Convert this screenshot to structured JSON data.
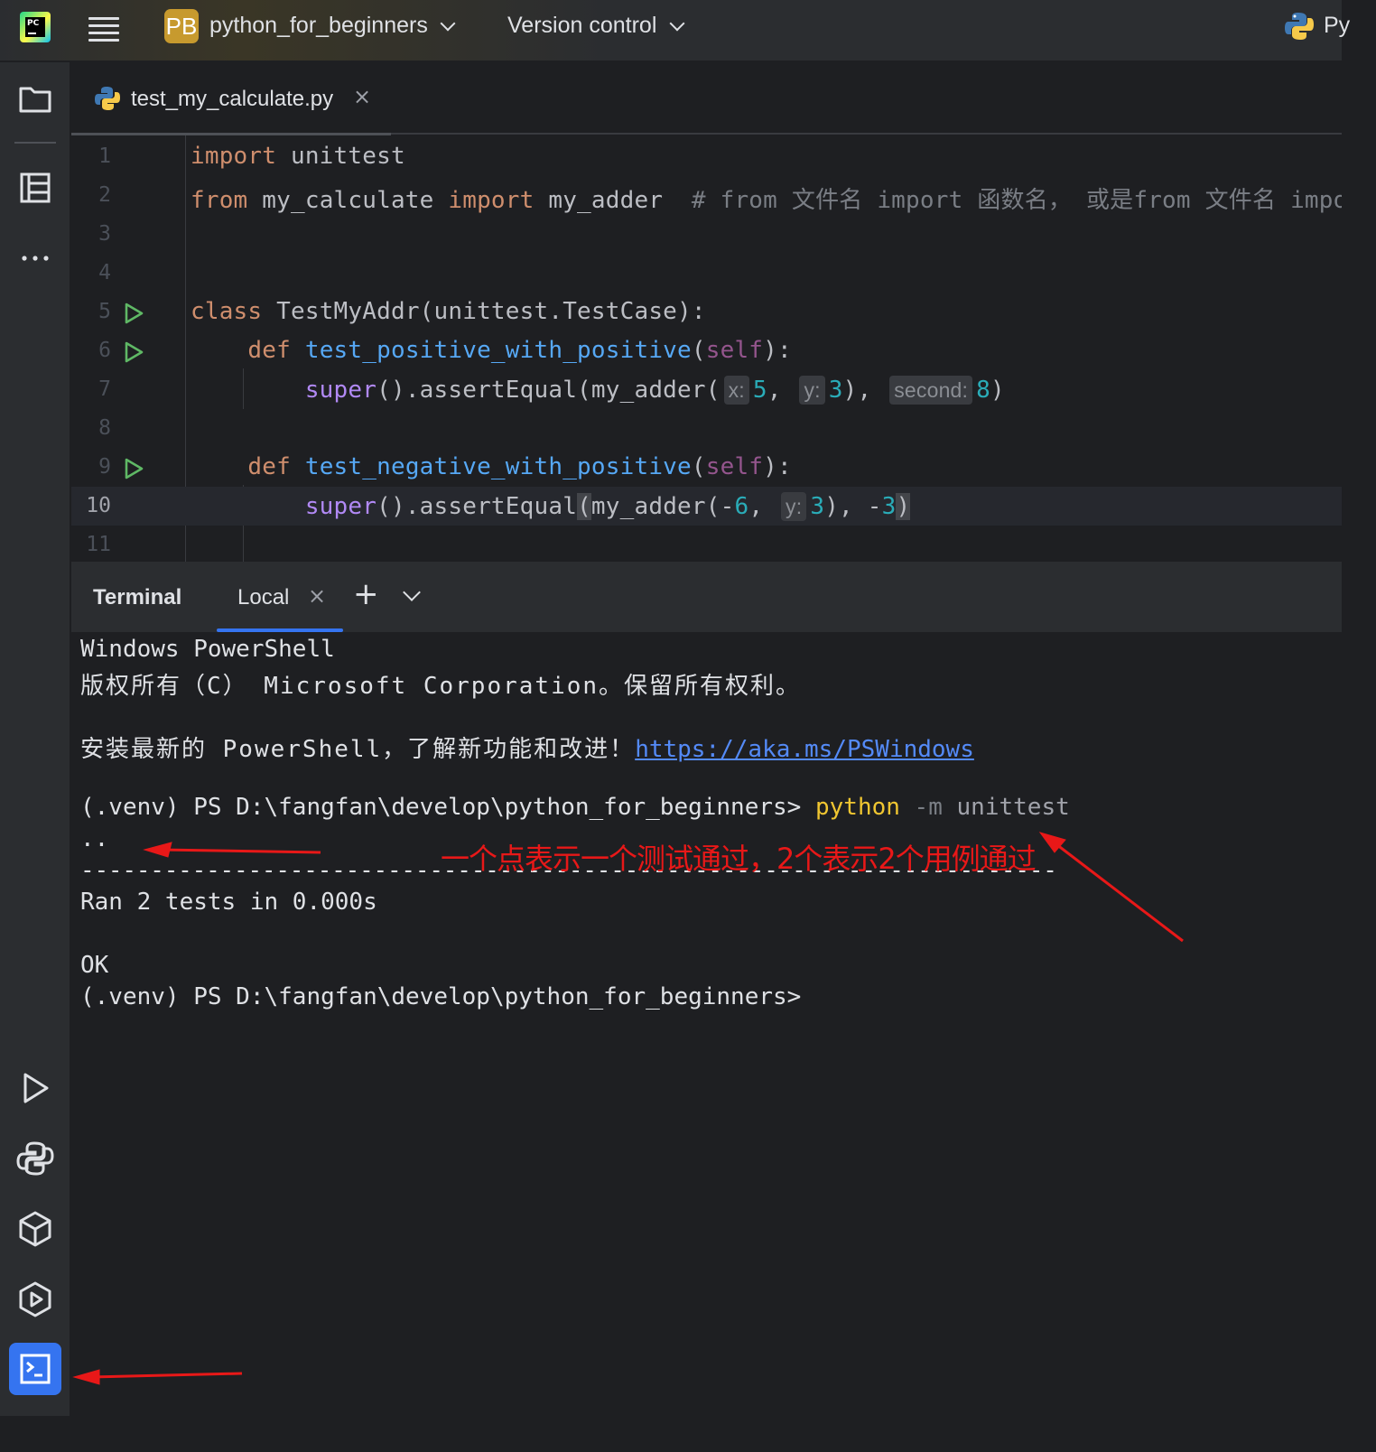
{
  "topbar": {
    "project_badge": "PB",
    "project_name": "python_for_beginners",
    "vcs_label": "Version control",
    "run_config_label": "Py"
  },
  "editor": {
    "tab_label": "test_my_calculate.py",
    "close_glyph": "×",
    "current_line": 10,
    "lines": [
      {
        "n": "1"
      },
      {
        "n": "2"
      },
      {
        "n": "3"
      },
      {
        "n": "4"
      },
      {
        "n": "5"
      },
      {
        "n": "6"
      },
      {
        "n": "7"
      },
      {
        "n": "8"
      },
      {
        "n": "9"
      },
      {
        "n": "10"
      },
      {
        "n": "11"
      }
    ],
    "code": {
      "l1_kw": "import",
      "l1_rest": " unittest",
      "l2_kw1": "from",
      "l2_mod": " my_calculate ",
      "l2_kw2": "import",
      "l2_name": " my_adder  ",
      "l2_comment": "# from 文件名 import 函数名， 或是from 文件名 import *",
      "l5_kw": "class",
      "l5_rest": " TestMyAddr(unittest.TestCase):",
      "l6_kw": "def",
      "l6_fn": "test_positive_with_positive",
      "l6_self": "self",
      "l6_end": "):",
      "l7_super": "super",
      "l7_a": "().assertEqual(my_adder(",
      "l7_hint_x": "x:",
      "l7_num1": "5",
      "l7_b": ", ",
      "l7_hint_y": "y:",
      "l7_num2": "3",
      "l7_c": "), ",
      "l7_hint_second": "second:",
      "l7_num3": "8",
      "l7_d": ")",
      "l9_kw": "def",
      "l9_fn": "test_negative_with_positive",
      "l9_self": "self",
      "l9_end": "):",
      "l10_super": "super",
      "l10_a": "().assertEqual",
      "l10_open": "(",
      "l10_b": "my_adder(-",
      "l10_num1": "6",
      "l10_c": ", ",
      "l10_hint_y": "y:",
      "l10_num2": "3",
      "l10_d": "), -",
      "l10_num3": "3",
      "l10_close": ")"
    }
  },
  "terminal": {
    "title": "Terminal",
    "tab_label": "Local",
    "close_glyph": "×",
    "add_glyph": "+",
    "lines": {
      "l1": "Windows PowerShell",
      "l2": "版权所有（C） Microsoft Corporation。保留所有权利。",
      "l3_text": "安装最新的 PowerShell，了解新功能和改进！",
      "l3_link": "https://aka.ms/PSWindows",
      "prompt1": "(.venv) PS D:\\fangfan\\develop\\python_for_beginners> ",
      "cmd": "python",
      "flag": " -m",
      "arg": " unittest",
      "dots": "..",
      "dashes": "----------------------------------------------------------------------",
      "ran": "Ran 2 tests in 0.000s",
      "ok": "OK",
      "prompt2": "(.venv) PS D:\\fangfan\\develop\\python_for_beginners>"
    }
  },
  "annotation": {
    "text": "一个点表示一个测试通过，2个表示2个用例通过",
    "color": "#e81818"
  },
  "colors": {
    "accent": "#3574f0",
    "keyword": "#cf8e6d",
    "function": "#56a8f5",
    "number": "#2aacb8",
    "run_icon": "#5fb865"
  },
  "icons": {
    "leftbar": [
      "folder-icon",
      "structure-icon",
      "more-icon",
      "run-icon",
      "python-console-icon",
      "python-packages-icon",
      "services-icon",
      "terminal-icon"
    ]
  }
}
